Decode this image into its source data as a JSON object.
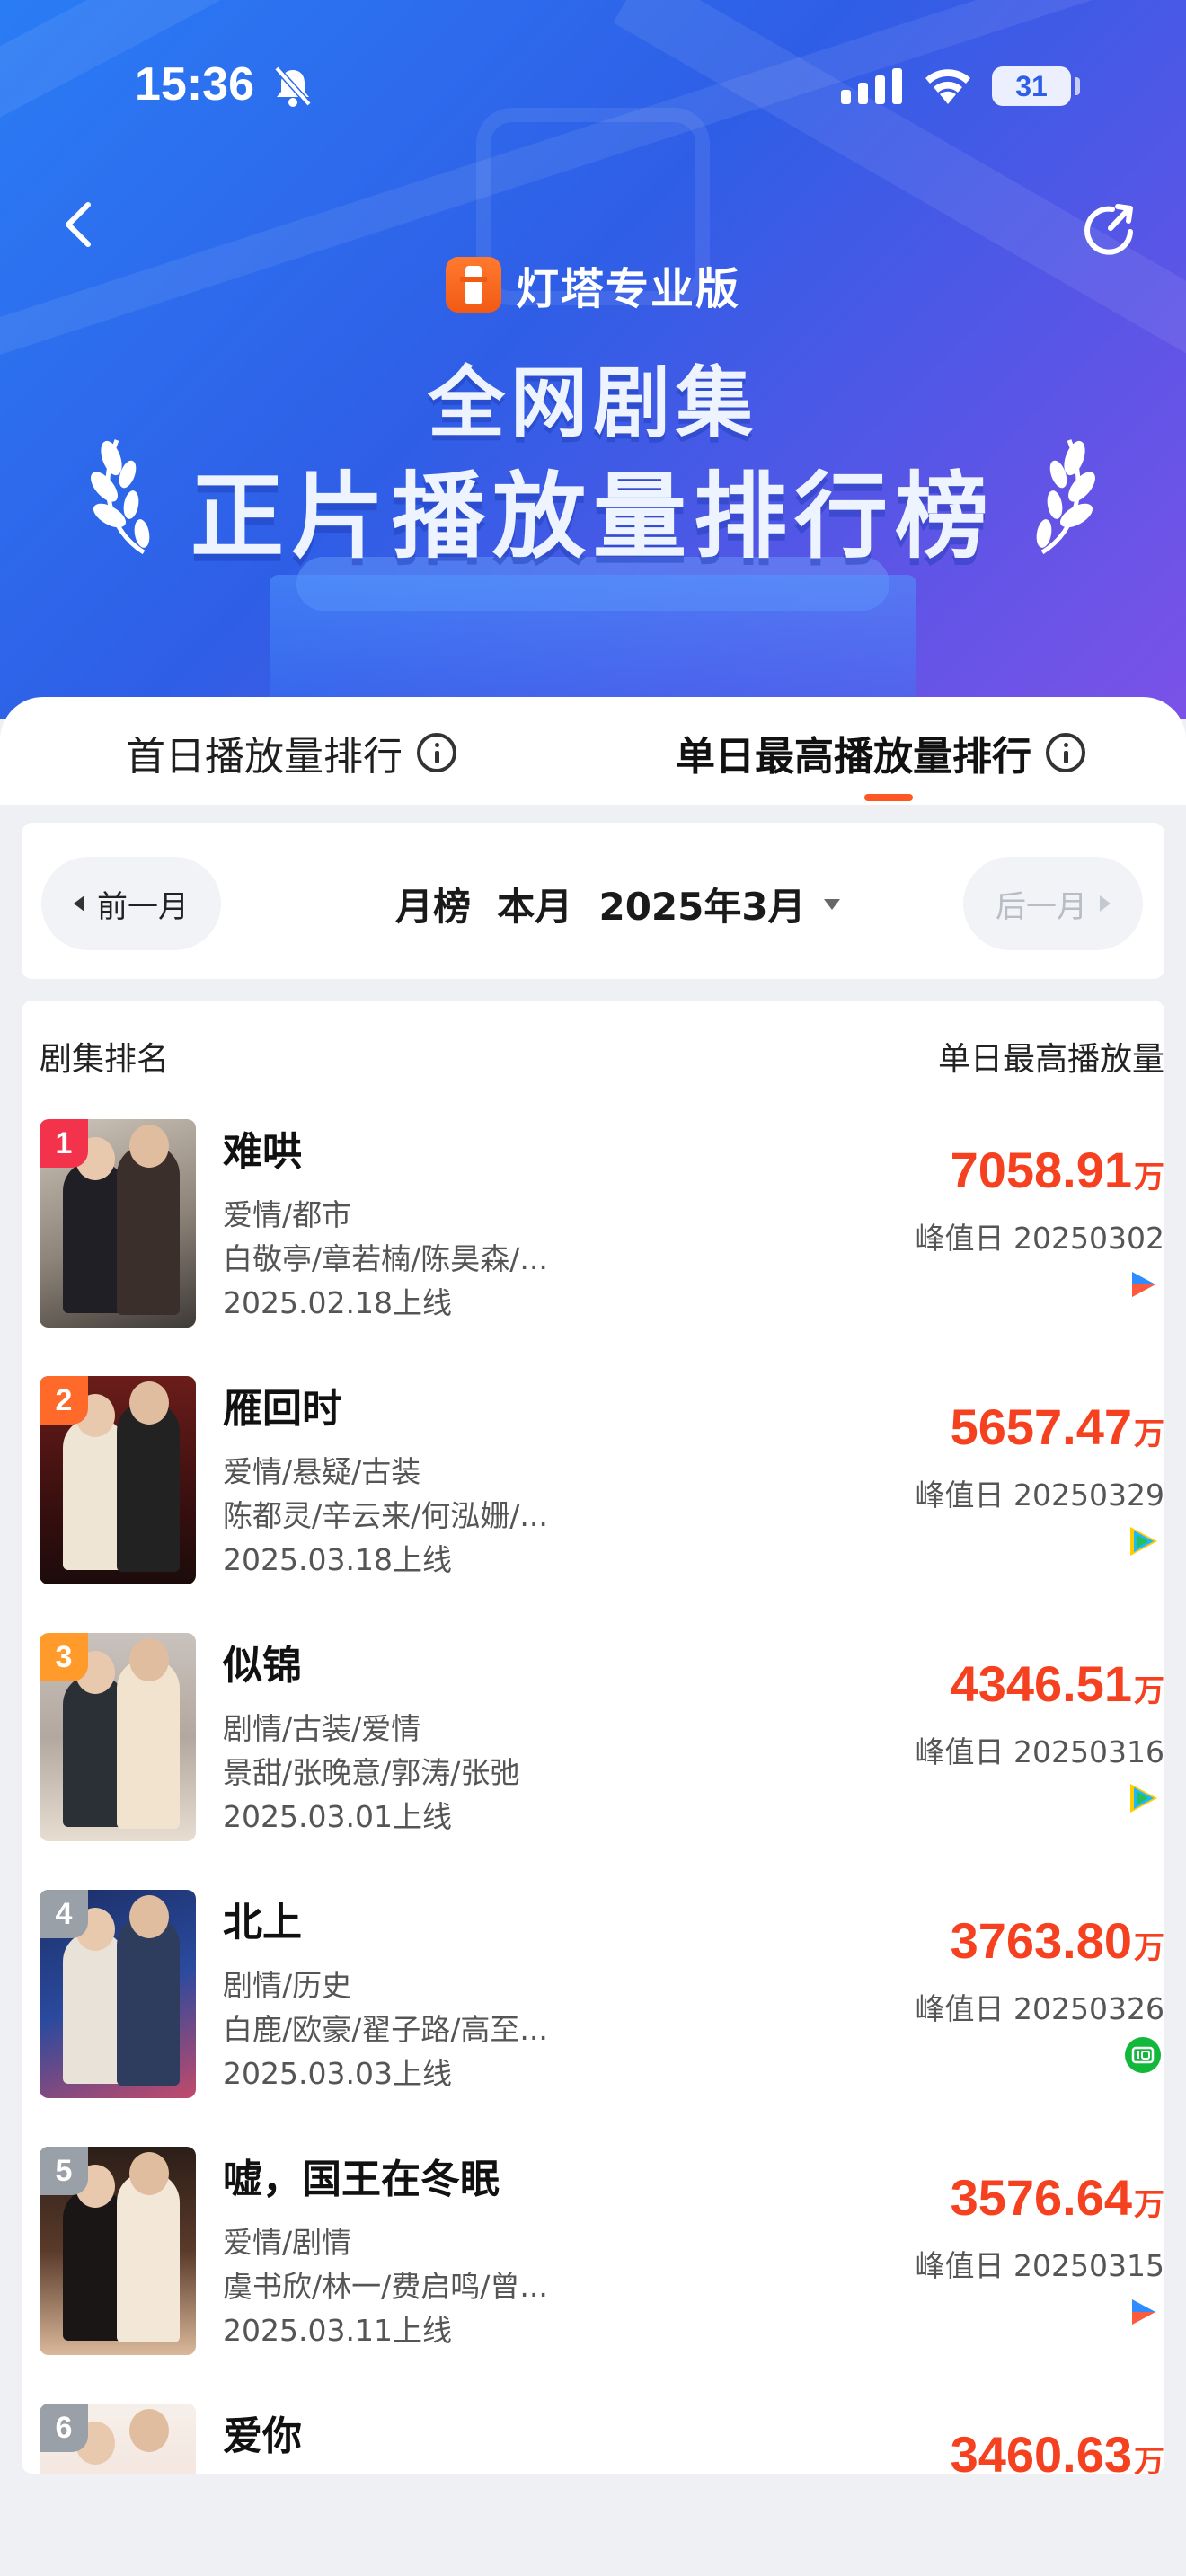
{
  "status_bar": {
    "time": "15:36",
    "battery": "31"
  },
  "brand": {
    "name": "灯塔专业版"
  },
  "hero": {
    "title_line1": "全网剧集",
    "title_line2": "正片播放量排行榜"
  },
  "tabs": [
    {
      "label": "首日播放量排行",
      "active": false
    },
    {
      "label": "单日最高播放量排行",
      "active": true
    }
  ],
  "month_nav": {
    "prev_label": "前一月",
    "current_label": "月榜  本月  2025年3月",
    "next_label": "后一月"
  },
  "list": {
    "header_left": "剧集排名",
    "header_right": "单日最高播放量",
    "unit": "万",
    "items": [
      {
        "rank": "1",
        "title": "难哄",
        "genre": "爱情/都市",
        "cast": "白敬亭/章若楠/陈昊森/...",
        "date": "2025.02.18上线",
        "value": "7058.91",
        "peak": "峰值日 20250302",
        "platform": "youku-icon",
        "badge_color": "#f3334b"
      },
      {
        "rank": "2",
        "title": "雁回时",
        "genre": "爱情/悬疑/古装",
        "cast": "陈都灵/辛云来/何泓姗/...",
        "date": "2025.03.18上线",
        "value": "5657.47",
        "peak": "峰值日 20250329",
        "platform": "tencent-video-icon",
        "badge_color": "#ff6a2b"
      },
      {
        "rank": "3",
        "title": "似锦",
        "genre": "剧情/古装/爱情",
        "cast": "景甜/张晚意/郭涛/张弛",
        "date": "2025.03.01上线",
        "value": "4346.51",
        "peak": "峰值日 20250316",
        "platform": "tencent-video-icon",
        "badge_color": "#ff9a2b"
      },
      {
        "rank": "4",
        "title": "北上",
        "genre": "剧情/历史",
        "cast": "白鹿/欧豪/翟子路/高至...",
        "date": "2025.03.03上线",
        "value": "3763.80",
        "peak": "峰值日 20250326",
        "platform": "iqiyi-icon",
        "badge_color": "#9aa0a8"
      },
      {
        "rank": "5",
        "title": "嘘，国王在冬眠",
        "genre": "爱情/剧情",
        "cast": "虞书欣/林一/费启鸣/曾...",
        "date": "2025.03.11上线",
        "value": "3576.64",
        "peak": "峰值日 20250315",
        "platform": "youku-icon",
        "badge_color": "#9aa0a8"
      },
      {
        "rank": "6",
        "title": "爱你",
        "genre": "",
        "cast": "",
        "date": "",
        "value": "3460.63",
        "peak": "",
        "platform": "",
        "badge_color": "#9aa0a8"
      }
    ]
  },
  "colors": {
    "accent": "#f5411f",
    "hero_start": "#2a7cf5",
    "hero_end": "#7b52e8"
  }
}
